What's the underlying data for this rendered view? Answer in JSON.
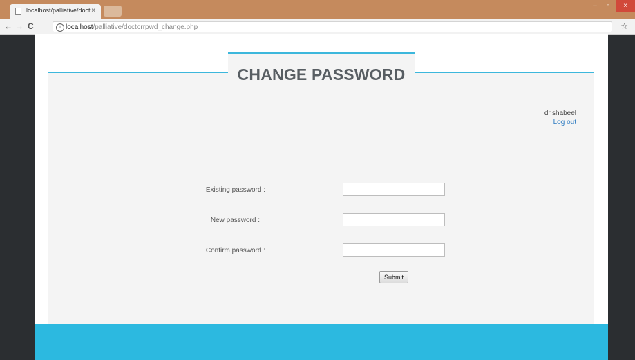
{
  "browser": {
    "tab_title": "localhost/palliative/doct",
    "tab_close": "×",
    "url_host": "localhost",
    "url_path": "/palliative/doctorrpwd_change.php",
    "back": "←",
    "forward": "→",
    "reload": "C",
    "bookmark": "☆",
    "win_min": "–",
    "win_max": "▫",
    "win_close": "×"
  },
  "header": {
    "title": "CHANGE PASSWORD"
  },
  "user": {
    "name": "dr.shabeel",
    "logout": "Log out"
  },
  "form": {
    "existing_label": "Existing password :",
    "new_label": "New password :",
    "confirm_label": "Confirm password :",
    "existing_value": "",
    "new_value": "",
    "confirm_value": "",
    "submit_label": "Submit"
  },
  "colors": {
    "accent": "#3cb7dc",
    "footer": "#2cb9e0",
    "title": "#585e63",
    "link": "#2a79c0"
  }
}
